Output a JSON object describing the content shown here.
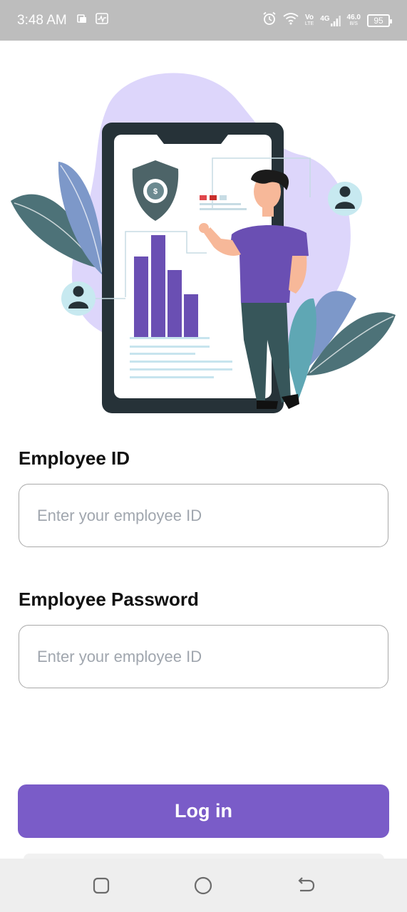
{
  "status_bar": {
    "time": "3:48 AM",
    "network_top": "Vo",
    "network_bottom": "LTE",
    "signal_label": "4G",
    "speed_value": "46.0",
    "speed_unit": "B/S",
    "battery": "95"
  },
  "form": {
    "employee_id_label": "Employee ID",
    "employee_id_placeholder": "Enter your employee ID",
    "password_label": "Employee Password",
    "password_placeholder": "Enter your employee ID",
    "login_label": "Log in"
  },
  "colors": {
    "accent": "#7a5cc8",
    "status_bar": "#bdbdbd",
    "blob": "#ddd6fb",
    "phone_frame": "#263238",
    "bars": "#6a4fb3",
    "leaf_dark": "#4d7278",
    "leaf_blue": "#7d98c9"
  },
  "icons": {
    "nav_recent": "square-icon",
    "nav_home": "circle-icon",
    "nav_back": "back-arrow-icon"
  }
}
